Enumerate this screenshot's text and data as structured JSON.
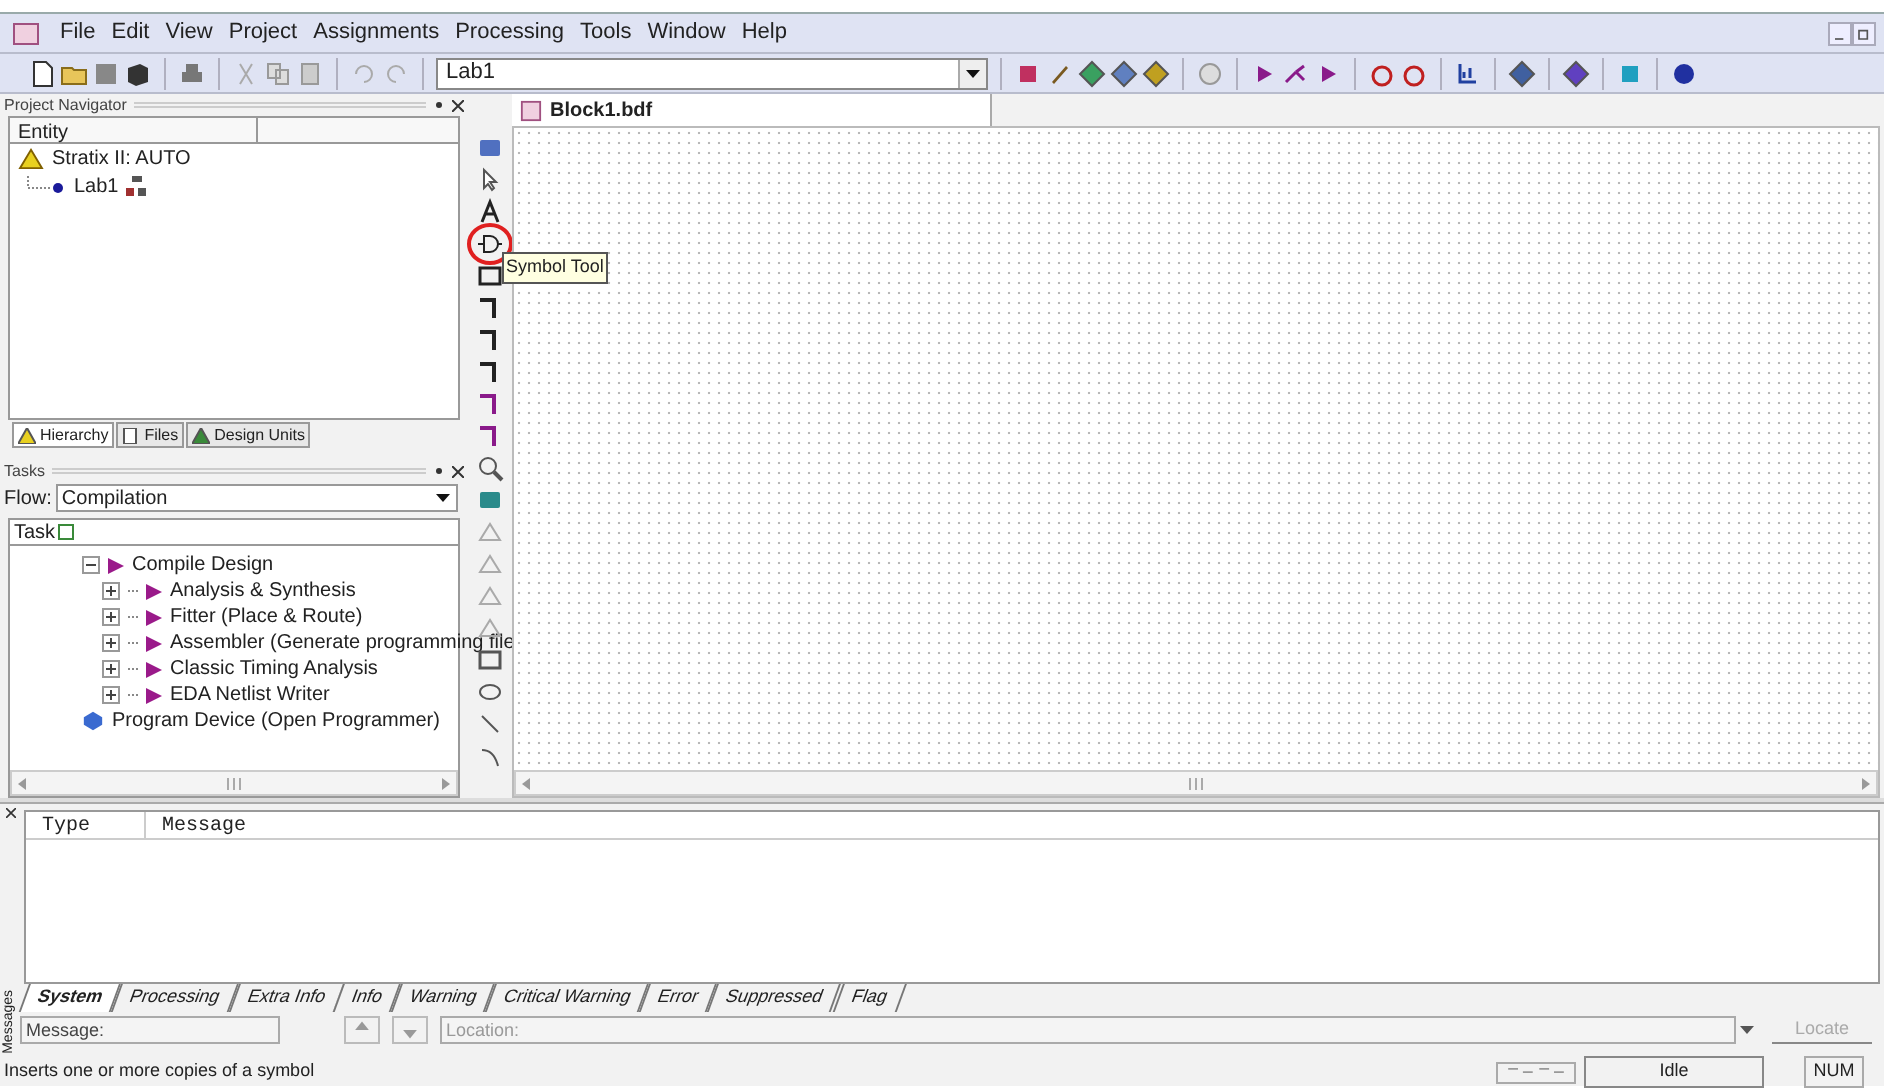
{
  "menu": [
    "File",
    "Edit",
    "View",
    "Project",
    "Assignments",
    "Processing",
    "Tools",
    "Window",
    "Help"
  ],
  "toolbar": {
    "project_combo": "Lab1"
  },
  "project_navigator": {
    "title": "Project Navigator",
    "column_1": "Entity",
    "items": [
      {
        "label": "Stratix II: AUTO",
        "kind": "device",
        "children": [
          {
            "label": "Lab1",
            "kind": "entity"
          }
        ]
      }
    ],
    "tabs": [
      {
        "label": "Hierarchy",
        "selected": true
      },
      {
        "label": "Files",
        "selected": false
      },
      {
        "label": "Design Units",
        "selected": false
      }
    ]
  },
  "tasks": {
    "title": "Tasks",
    "flow_label": "Flow:",
    "flow_value": "Compilation",
    "column_1": "Task",
    "items": [
      {
        "label": "Compile Design",
        "kind": "step",
        "expanded": true,
        "children": [
          {
            "label": "Analysis & Synthesis",
            "kind": "step",
            "expanded": false
          },
          {
            "label": "Fitter (Place & Route)",
            "kind": "step",
            "expanded": false
          },
          {
            "label": "Assembler (Generate programming file",
            "kind": "step",
            "expanded": false
          },
          {
            "label": "Classic Timing Analysis",
            "kind": "step",
            "expanded": false
          },
          {
            "label": "EDA Netlist Writer",
            "kind": "step",
            "expanded": false
          }
        ]
      },
      {
        "label": "Program Device (Open Programmer)",
        "kind": "program"
      }
    ]
  },
  "editor": {
    "tab": "Block1.bdf",
    "tooltip": "Symbol Tool"
  },
  "messages": {
    "side_label": "Messages",
    "columns": [
      "Type",
      "Message"
    ],
    "tabs": [
      {
        "label": "System",
        "selected": true
      },
      {
        "label": "Processing",
        "selected": false
      },
      {
        "label": "Extra Info",
        "selected": false
      },
      {
        "label": "Info",
        "selected": false
      },
      {
        "label": "Warning",
        "selected": false
      },
      {
        "label": "Critical Warning",
        "selected": false
      },
      {
        "label": "Error",
        "selected": false
      },
      {
        "label": "Suppressed",
        "selected": false
      },
      {
        "label": "Flag",
        "selected": false
      }
    ],
    "message_label": "Message:",
    "location_placeholder": "Location:",
    "locate_button": {
      "label": "Locate",
      "disabled": true
    }
  },
  "status_bar": {
    "hint": "Inserts one or more copies of a symbol",
    "state": "Idle",
    "num": "NUM"
  }
}
